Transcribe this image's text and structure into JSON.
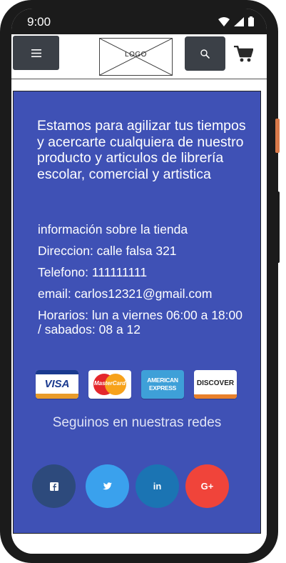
{
  "status_bar": {
    "time": "9:00",
    "icons": [
      "wifi-icon",
      "signal-icon",
      "battery-icon"
    ]
  },
  "header": {
    "menu_icon": "menu-icon",
    "logo_text": "LOGO",
    "search_icon": "search-icon",
    "cart_icon": "cart-icon"
  },
  "content": {
    "intro": "Estamos para agilizar tus tiempos y acercarte cualquiera de nuestro producto y articulos  de librería escolar, comercial y artistica",
    "info": {
      "title": "información sobre la tienda",
      "address": "Direccion: calle falsa 321",
      "phone": "Telefono: 111111111",
      "email": "email: carlos12321@gmail.com",
      "hours": "Horarios: lun a viernes 06:00 a 18:00 / sabados: 08 a 12"
    },
    "payments": {
      "visa": "VISA",
      "mastercard": "MasterCard",
      "amex_line1": "AMERICAN",
      "amex_line2": "EXPRESS",
      "discover": "DISCOVER"
    },
    "social_title": "Seguinos en nuestras redes",
    "social": {
      "facebook": "f",
      "twitter": "twitter",
      "linkedin": "in",
      "google": "G+"
    }
  },
  "colors": {
    "brand": "#3f51b5",
    "nav_button": "#3b4047",
    "facebook": "#2d4a7c",
    "twitter": "#3aa1ed",
    "linkedin": "#1b74b3",
    "google": "#f0443a"
  }
}
